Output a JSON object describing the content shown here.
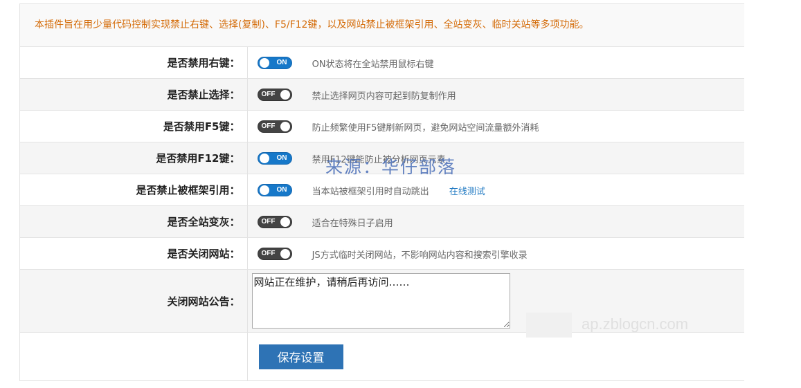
{
  "notice": "本插件旨在用少量代码控制实现禁止右键、选择(复制)、F5/F12键，以及网站禁止被框架引用、全站变灰、临时关站等多项功能。",
  "settings": [
    {
      "label": "是否禁用右键：",
      "state": "ON",
      "desc": "ON状态将在全站禁用鼠标右键"
    },
    {
      "label": "是否禁止选择：",
      "state": "OFF",
      "desc": "禁止选择网页内容可起到防复制作用"
    },
    {
      "label": "是否禁用F5键：",
      "state": "OFF",
      "desc": "防止频繁使用F5键刷新网页，避免网站空间流量额外消耗"
    },
    {
      "label": "是否禁用F12键：",
      "state": "ON",
      "desc": "禁用F12键能防止被分析网页元素"
    },
    {
      "label": "是否禁止被框架引用：",
      "state": "ON",
      "desc": "当本站被框架引用时自动跳出",
      "link": "在线测试"
    },
    {
      "label": "是否全站变灰：",
      "state": "OFF",
      "desc": "适合在特殊日子启用"
    },
    {
      "label": "是否关闭网站：",
      "state": "OFF",
      "desc": "JS方式临时关闭网站，不影响网站内容和搜索引擎收录"
    }
  ],
  "close_notice": {
    "label": "关闭网站公告：",
    "value": "网站正在维护，请稍后再访问……"
  },
  "save_label": "保存设置",
  "watermark": "来源：华仔部落",
  "watermark2": "ap.zblogcn.com",
  "colors": {
    "switch_on": "#1678c9",
    "switch_off": "#444444",
    "notice_text": "#d46b08",
    "link": "#1f79c2",
    "button": "#2e73b5"
  }
}
